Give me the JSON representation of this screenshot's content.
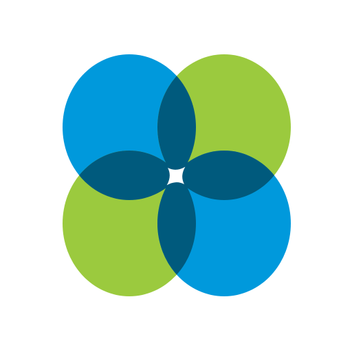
{
  "logo": {
    "icon": "four-circle-clover-logo-icon",
    "colors": {
      "background": "#ffffff",
      "blue": "#0099DC",
      "green": "#9BCA3E",
      "overlap": "#005A7D",
      "center": "#ffffff"
    }
  }
}
